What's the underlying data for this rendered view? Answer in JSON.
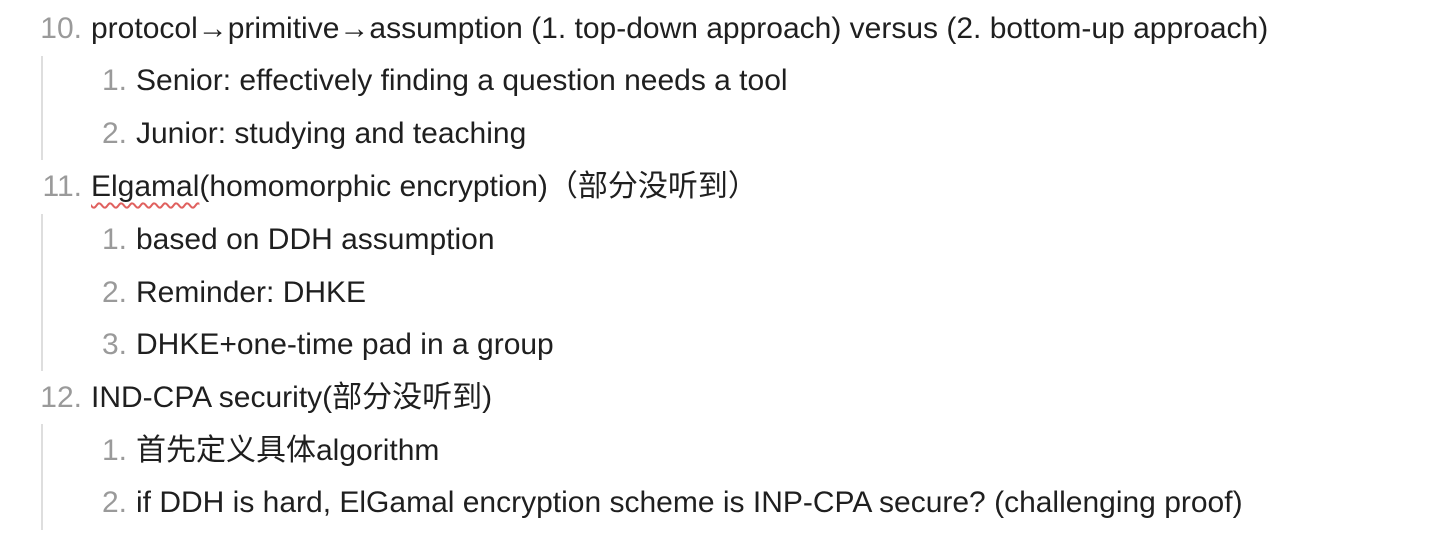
{
  "outline": {
    "items": [
      {
        "number": "10.",
        "text": "protocol→primitive→assumption (1. top-down approach) versus (2. bottom-up approach)",
        "children": [
          {
            "number": "1.",
            "text": "Senior: effectively finding a question needs a tool"
          },
          {
            "number": "2.",
            "text": "Junior: studying and teaching"
          }
        ]
      },
      {
        "number": "11.",
        "text_misspelled": "Elgamal",
        "text_rest": "(homomorphic encryption)（部分没听到）",
        "children": [
          {
            "number": "1.",
            "text": "based on DDH assumption"
          },
          {
            "number": "2.",
            "text": "Reminder: DHKE"
          },
          {
            "number": "3.",
            "text": "DHKE+one-time pad in a group"
          }
        ]
      },
      {
        "number": "12.",
        "text": "IND-CPA security(部分没听到)",
        "children": [
          {
            "number": "1.",
            "text": "首先定义具体algorithm"
          },
          {
            "number": "2.",
            "text": "if DDH is hard, ElGamal encryption scheme is INP-CPA secure? (challenging proof)"
          }
        ]
      }
    ]
  }
}
